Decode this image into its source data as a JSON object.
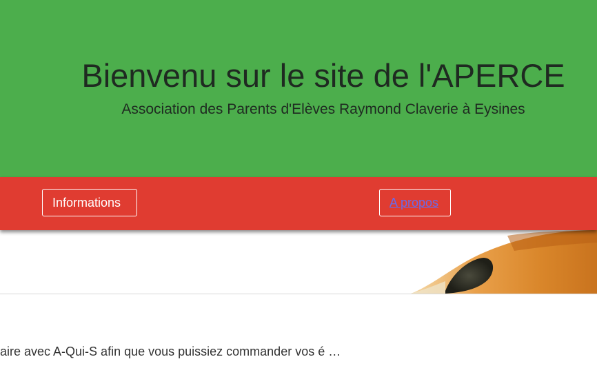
{
  "header": {
    "title": "Bienvenu sur le site de l'APERCE",
    "subtitle": "Association des Parents d'Elèves Raymond Claverie à Eysines"
  },
  "nav": {
    "items": [
      {
        "label": "Informations"
      },
      {
        "label": "A propos"
      }
    ]
  },
  "content": {
    "excerpt": "aire avec A-Qui-S afin que vous puissiez commander vos é …"
  },
  "colors": {
    "header_bg": "#4cae4c",
    "nav_bg": "#e03c31",
    "link": "#6a6ae8"
  },
  "icons": {
    "banner_image": "pencil-tip-image"
  }
}
